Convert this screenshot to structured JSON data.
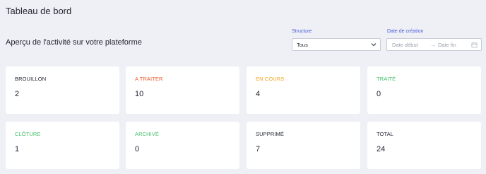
{
  "header": {
    "title": "Tableau de bord",
    "subtitle": "Aperçu de l'activité sur votre plateforme"
  },
  "filters": {
    "structure_label": "Structure",
    "structure_value": "Tous",
    "date_label": "Date de création",
    "date_start_placeholder": "Date début",
    "date_arrow": "→",
    "date_end_placeholder": "Date fin"
  },
  "cards": [
    {
      "label": "BROUILLON",
      "value": "2",
      "color": "#1f2330"
    },
    {
      "label": "A TRAITER",
      "value": "10",
      "color": "#ef5a2b"
    },
    {
      "label": "EN COURS",
      "value": "4",
      "color": "#f5a623"
    },
    {
      "label": "TRAITÉ",
      "value": "0",
      "color": "#45c06a"
    },
    {
      "label": "CLÔTURE",
      "value": "1",
      "color": "#45c06a"
    },
    {
      "label": "ARCHIVÉ",
      "value": "0",
      "color": "#45c06a"
    },
    {
      "label": "SUPPRIMÉ",
      "value": "7",
      "color": "#1f2330"
    },
    {
      "label": "TOTAL",
      "value": "24",
      "color": "#1f2330"
    }
  ],
  "icons": {
    "select_chevron": "chevron-down-icon",
    "date_picker": "calendar-icon"
  }
}
